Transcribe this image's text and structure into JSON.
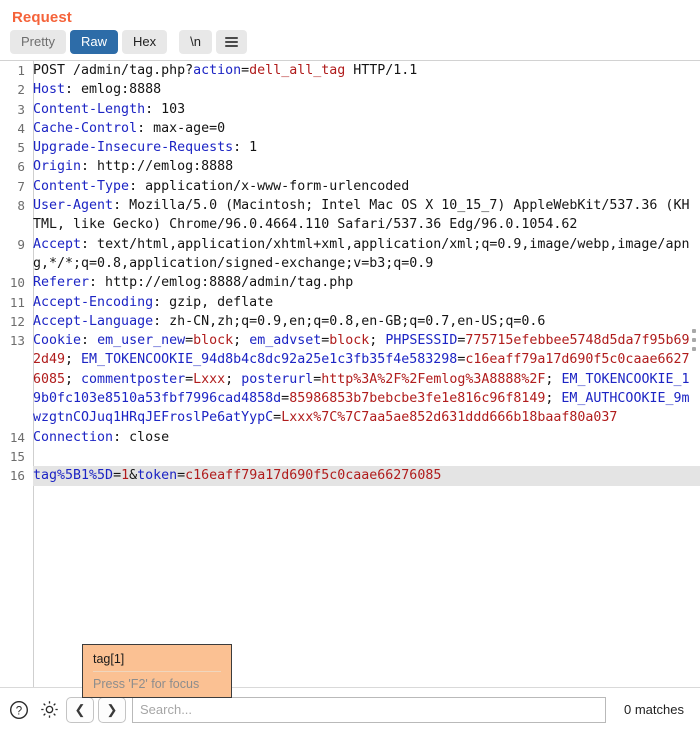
{
  "panel": {
    "title": "Request",
    "title_color": "#f5633a"
  },
  "tabs": [
    {
      "label": "Pretty",
      "active": false
    },
    {
      "label": "Raw",
      "active": true
    },
    {
      "label": "Hex",
      "active": false
    },
    {
      "label": "\\n",
      "active": false
    },
    {
      "label": "menu-icon",
      "active": false
    }
  ],
  "tab_active_color": "#2d6ca8",
  "editor": {
    "lines": [
      {
        "n": "1",
        "highlighted": false,
        "tokens": [
          {
            "t": "POST /admin/tag.php?",
            "c": "p"
          },
          {
            "t": "action",
            "c": "k"
          },
          {
            "t": "=",
            "c": "p"
          },
          {
            "t": "dell_all_tag",
            "c": "v"
          },
          {
            "t": " HTTP/1.1",
            "c": "p"
          }
        ]
      },
      {
        "n": "2",
        "highlighted": false,
        "tokens": [
          {
            "t": "Host",
            "c": "k"
          },
          {
            "t": ": emlog:8888",
            "c": "p"
          }
        ]
      },
      {
        "n": "3",
        "highlighted": false,
        "tokens": [
          {
            "t": "Content-Length",
            "c": "k"
          },
          {
            "t": ": 103",
            "c": "p"
          }
        ]
      },
      {
        "n": "4",
        "highlighted": false,
        "tokens": [
          {
            "t": "Cache-Control",
            "c": "k"
          },
          {
            "t": ": max-age=0",
            "c": "p"
          }
        ]
      },
      {
        "n": "5",
        "highlighted": false,
        "tokens": [
          {
            "t": "Upgrade-Insecure-Requests",
            "c": "k"
          },
          {
            "t": ": 1",
            "c": "p"
          }
        ]
      },
      {
        "n": "6",
        "highlighted": false,
        "tokens": [
          {
            "t": "Origin",
            "c": "k"
          },
          {
            "t": ": http://emlog:8888",
            "c": "p"
          }
        ]
      },
      {
        "n": "7",
        "highlighted": false,
        "tokens": [
          {
            "t": "Content-Type",
            "c": "k"
          },
          {
            "t": ": application/x-www-form-urlencoded",
            "c": "p"
          }
        ]
      },
      {
        "n": "8",
        "highlighted": false,
        "tokens": [
          {
            "t": "User-Agent",
            "c": "k"
          },
          {
            "t": ": Mozilla/5.0 (Macintosh; Intel Mac OS X 10_15_7) AppleWebKit/537.36 (KHTML, like Gecko) Chrome/96.0.4664.110 Safari/537.36 Edg/96.0.1054.62",
            "c": "p"
          }
        ]
      },
      {
        "n": "9",
        "highlighted": false,
        "tokens": [
          {
            "t": "Accept",
            "c": "k"
          },
          {
            "t": ": text/html,application/xhtml+xml,application/xml;q=0.9,image/webp,image/apng,*/*;q=0.8,application/signed-exchange;v=b3;q=0.9",
            "c": "p"
          }
        ]
      },
      {
        "n": "10",
        "highlighted": false,
        "tokens": [
          {
            "t": "Referer",
            "c": "k"
          },
          {
            "t": ": http://emlog:8888/admin/tag.php",
            "c": "p"
          }
        ]
      },
      {
        "n": "11",
        "highlighted": false,
        "tokens": [
          {
            "t": "Accept-Encoding",
            "c": "k"
          },
          {
            "t": ": gzip, deflate",
            "c": "p"
          }
        ]
      },
      {
        "n": "12",
        "highlighted": false,
        "tokens": [
          {
            "t": "Accept-Language",
            "c": "k"
          },
          {
            "t": ": zh-CN,zh;q=0.9,en;q=0.8,en-GB;q=0.7,en-US;q=0.6",
            "c": "p"
          }
        ]
      },
      {
        "n": "13",
        "highlighted": false,
        "tokens": [
          {
            "t": "Cookie",
            "c": "k"
          },
          {
            "t": ": ",
            "c": "p"
          },
          {
            "t": "em_user_new",
            "c": "k"
          },
          {
            "t": "=",
            "c": "p"
          },
          {
            "t": "block",
            "c": "v"
          },
          {
            "t": "; ",
            "c": "p"
          },
          {
            "t": "em_advset",
            "c": "k"
          },
          {
            "t": "=",
            "c": "p"
          },
          {
            "t": "block",
            "c": "v"
          },
          {
            "t": "; ",
            "c": "p"
          },
          {
            "t": "PHPSESSID",
            "c": "k"
          },
          {
            "t": "=",
            "c": "p"
          },
          {
            "t": "775715efebbee5748d5da7f95b692d49",
            "c": "v"
          },
          {
            "t": "; ",
            "c": "p"
          },
          {
            "t": "EM_TOKENCOOKIE_94d8b4c8dc92a25e1c3fb35f4e583298",
            "c": "k"
          },
          {
            "t": "=",
            "c": "p"
          },
          {
            "t": "c16eaff79a17d690f5c0caae66276085",
            "c": "v"
          },
          {
            "t": "; ",
            "c": "p"
          },
          {
            "t": "commentposter",
            "c": "k"
          },
          {
            "t": "=",
            "c": "p"
          },
          {
            "t": "Lxxx",
            "c": "v"
          },
          {
            "t": "; ",
            "c": "p"
          },
          {
            "t": "posterurl",
            "c": "k"
          },
          {
            "t": "=",
            "c": "p"
          },
          {
            "t": "http%3A%2F%2Femlog%3A8888%2F",
            "c": "v"
          },
          {
            "t": "; ",
            "c": "p"
          },
          {
            "t": "EM_TOKENCOOKIE_19b0fc103e8510a53fbf7996cad4858d",
            "c": "k"
          },
          {
            "t": "=",
            "c": "p"
          },
          {
            "t": "85986853b7bebcbe3fe1e816c96f8149",
            "c": "v"
          },
          {
            "t": "; ",
            "c": "p"
          },
          {
            "t": "EM_AUTHCOOKIE_9mwzgtnCOJuq1HRqJEFroslPe6atYypC",
            "c": "k"
          },
          {
            "t": "=",
            "c": "p"
          },
          {
            "t": "Lxxx%7C%7C7aa5ae852d631ddd666b18baaf80a037",
            "c": "v"
          }
        ]
      },
      {
        "n": "14",
        "highlighted": false,
        "tokens": [
          {
            "t": "Connection",
            "c": "k"
          },
          {
            "t": ": close",
            "c": "p"
          }
        ]
      },
      {
        "n": "15",
        "highlighted": false,
        "tokens": [
          {
            "t": "",
            "c": "p"
          }
        ]
      },
      {
        "n": "16",
        "highlighted": true,
        "tokens": [
          {
            "t": "tag%5B1%5D",
            "c": "k"
          },
          {
            "t": "=",
            "c": "p"
          },
          {
            "t": "1",
            "c": "v"
          },
          {
            "t": "&",
            "c": "p"
          },
          {
            "t": "token",
            "c": "k"
          },
          {
            "t": "=",
            "c": "p"
          },
          {
            "t": "c16eaff79a17d690f5c0caae66276085",
            "c": "v"
          }
        ]
      }
    ]
  },
  "tooltip": {
    "title": "tag[1]",
    "hint": "Press 'F2' for focus",
    "background": "#fbc193"
  },
  "bottom_bar": {
    "help_icon": "question-circle-icon",
    "settings_icon": "gear-icon",
    "prev_label": "❮",
    "next_label": "❯",
    "search_value": "",
    "search_placeholder": "Search...",
    "matches_label": "0 matches"
  }
}
